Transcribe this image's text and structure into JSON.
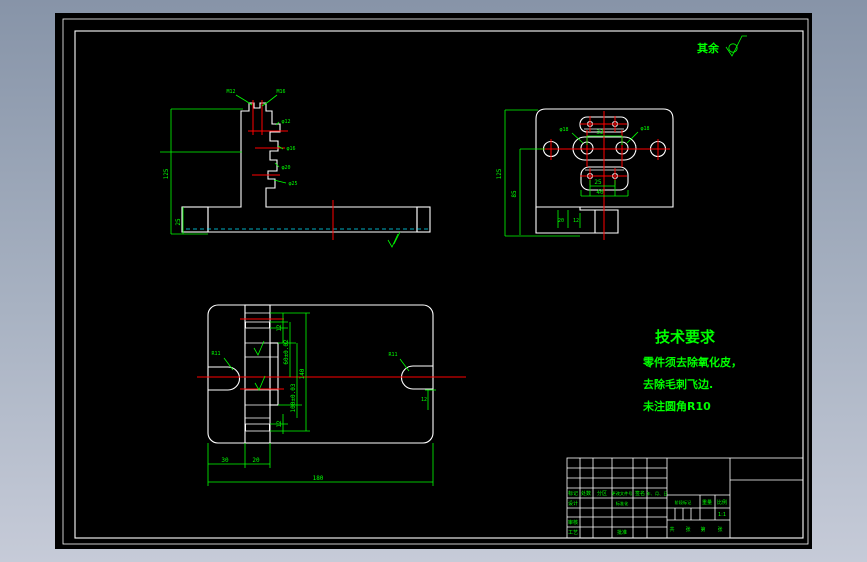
{
  "colors": {
    "background_top": "#8794A8",
    "background_bottom": "#C6CBD8",
    "paper": "#000000",
    "outline": "#FFFFFF",
    "dimension": "#00FF00",
    "centerline": "#FF0000",
    "hatch": "#00E5FF"
  },
  "annotation": {
    "rest": "其余"
  },
  "tech": {
    "title": "技术要求",
    "l1": "零件须去除氧化皮，",
    "l2": "去除毛刺飞边.",
    "l3": "未注圆角R10"
  },
  "sec": {
    "d1": "125",
    "d2": "25",
    "t1": "M12",
    "t2": "M16",
    "c1": "φ12",
    "c2": "φ16",
    "c3": "φ20",
    "c4": "φ25"
  },
  "top": {
    "d1": "125",
    "d2": "85",
    "d3": "32",
    "d4": "25",
    "d5": "40",
    "d6": "20",
    "d7": "12",
    "h1": "φ18",
    "h2": "φ18"
  },
  "bot": {
    "d1": "12",
    "d2": "60±0.02",
    "d3": "140",
    "d4": "100±0.03",
    "d5": "12",
    "d6": "30",
    "d7": "20",
    "d8": "180",
    "d9": "12",
    "r1": "R11",
    "r2": "R11"
  },
  "tb": {
    "h1": "标记",
    "h2": "处数",
    "h3": "分区",
    "h4": "更改文件号",
    "h5": "签名",
    "h6": "年、月、日",
    "design": "设计",
    "std": "标准化",
    "check": "审核",
    "proc": "工艺",
    "appr": "批准",
    "stage": "阶段标记",
    "weight": "重量",
    "scale": "比例",
    "scalev": "1:1",
    "s1": "共",
    "s2": "张",
    "s3": "第",
    "s4": "张"
  }
}
